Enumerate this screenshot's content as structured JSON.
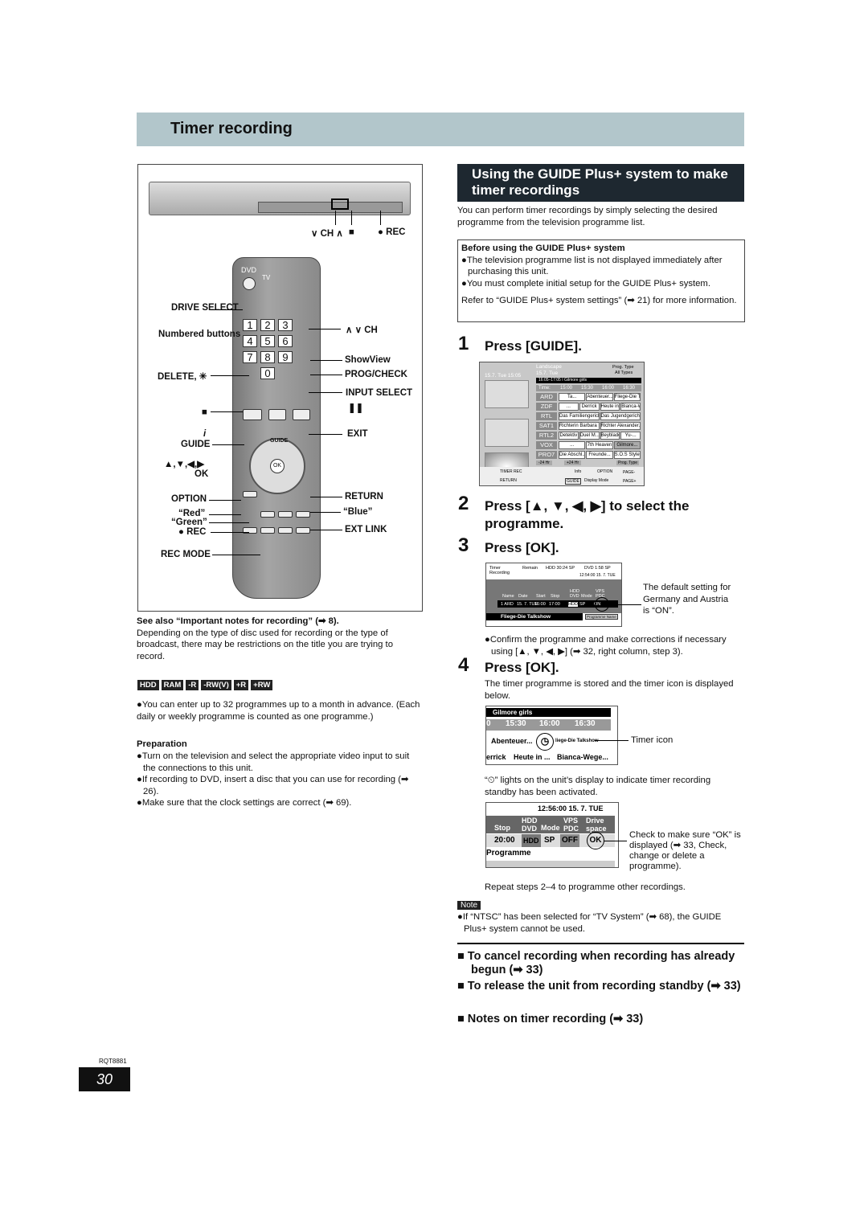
{
  "header": {
    "title": "Timer recording"
  },
  "left": {
    "unit_labels": {
      "ch": "∨ CH ∧",
      "stop": "■",
      "rec": "● REC"
    },
    "remote_labels_left": [
      "DRIVE SELECT",
      "Numbered buttons",
      "DELETE, ✳",
      "■",
      "i",
      "GUIDE",
      "▲,▼,◀,▶",
      "OK",
      "OPTION",
      "“Red”",
      "“Green”",
      "● REC",
      "REC MODE"
    ],
    "remote_labels_right": [
      "∧ ∨ CH",
      "ShowView",
      "PROG/CHECK",
      "INPUT SELECT",
      "❚❚",
      "EXIT",
      "RETURN",
      "“Blue”",
      "EXT LINK"
    ],
    "remote_text": {
      "dvd": "DVD",
      "tv": "TV",
      "guide": "GUIDE",
      "ok": "OK",
      "keys": [
        "1",
        "2",
        "3",
        "4",
        "5",
        "6",
        "7",
        "8",
        "9",
        "0"
      ]
    },
    "see_also": "See also “Important notes for recording” (➡ 8).",
    "restriction": "Depending on the type of disc used for recording or the type of broadcast, there may be restrictions on the title you are trying to record.",
    "discs": [
      "HDD",
      "RAM",
      "-R",
      "-RW(V)",
      "+R",
      "+RW"
    ],
    "programmes_note": "●You can enter up to 32 programmes up to a month in advance. (Each daily or weekly programme is counted as one programme.)",
    "preparation_title": "Preparation",
    "preparation": [
      "●Turn on the television and select the appropriate video input to suit the connections to this unit.",
      "●If recording to DVD, insert a disc that you can use for recording (➡ 26).",
      "●Make sure that the clock settings are correct (➡ 69)."
    ]
  },
  "right": {
    "section_title": "Using the GUIDE Plus+ system to make timer recordings",
    "intro": "You can perform timer recordings by simply selecting the desired programme from the television programme list.",
    "before": {
      "title": "Before using the GUIDE Plus+ system",
      "items": [
        "●The television programme list is not displayed immediately after purchasing this unit.",
        "●You must complete initial setup for the GUIDE Plus+ system."
      ],
      "refer": "Refer to “GUIDE Plus+ system settings” (➡ 21) for more information."
    },
    "steps": [
      {
        "num": "1",
        "text": "Press [GUIDE]."
      },
      {
        "num": "2",
        "text": "Press [▲, ▼, ◀, ▶] to select the programme."
      },
      {
        "num": "3",
        "text": "Press [OK]."
      },
      {
        "num": "4",
        "text": "Press [OK]."
      }
    ],
    "guide_screen": {
      "date": "15.7. Tue   15:05",
      "landscape": "Landscape",
      "date2": "15.7. Tue",
      "prog_type": "Prog. Type",
      "all_types": "All Types",
      "info_bar": "16:05–17:05 I     Gilmore girls",
      "time_label": "Time:",
      "times": [
        "15:00",
        "15:30",
        "16:00",
        "16:30"
      ],
      "channels": [
        {
          "ch": "ARD",
          "progs": [
            "Ta...",
            "Abenteuer...",
            "Fliege-Die Talkshow"
          ]
        },
        {
          "ch": "ZDF",
          "progs": [
            "...",
            "Derrick",
            "Heute in ...",
            "Bianca-Wege..."
          ]
        },
        {
          "ch": "RTL",
          "progs": [
            "Das Familiengericht",
            "Das Jugendgericht"
          ]
        },
        {
          "ch": "SAT1",
          "progs": [
            "Richterin Barbara Sa...",
            "Richter Alexander..."
          ]
        },
        {
          "ch": "RTL2",
          "progs": [
            "Detektiv",
            "Duel M...",
            "Beyblade",
            "Yu-..."
          ]
        },
        {
          "ch": "VOX",
          "progs": [
            "...",
            "7th Heaven",
            "Gilmore..."
          ]
        },
        {
          "ch": "PRO7",
          "progs": [
            "Die Abschl...",
            "Freunde...",
            "S.O.S Style &..."
          ]
        }
      ],
      "footer": [
        "-24 Hr",
        "+24 Hr",
        "Prog. Type",
        "TIMER REC",
        "Info",
        "OPTION",
        "PAGE-",
        "RETURN",
        "GUIDE",
        "Display Mode",
        "PAGE+"
      ]
    },
    "timer_screen": {
      "title": "Timer Recording",
      "remain": "Remain",
      "hdd": "HDD  30:24 SP",
      "dvd": "DVD  1:58 SP",
      "clock": "12:54:00  15. 7.  TUE",
      "cols": [
        "Name",
        "Date",
        "Start",
        "Stop",
        "HDD DVD",
        "Mode",
        "VPS PDC"
      ],
      "row": [
        "1 ARD",
        "15. 7. TUE",
        "16:00",
        "17:00",
        "HDD",
        "SP",
        "ON"
      ],
      "prog": "Fliege-Die Talkshow",
      "prog_btn": "Programme Name"
    },
    "default_note": "The default setting for Germany and Austria is “ON”.",
    "confirm": "●Confirm the programme and make corrections if necessary using [▲, ▼, ◀, ▶] (➡ 32, right column, step 3).",
    "stored": "The timer programme is stored and the timer icon is displayed below.",
    "timer_icon_screen": {
      "title": "Gilmore girls",
      "times": [
        "0",
        "15:30",
        "16:00",
        "16:30"
      ],
      "row1": [
        "Abenteuer...",
        "liege-Die Talkshow"
      ],
      "row2": [
        "errick",
        "Heute in ...",
        "Bianca-Wege..."
      ]
    },
    "timer_icon_label": "Timer icon",
    "lights": "“⏲” lights on the unit’s display to indicate timer recording standby has been activated.",
    "drive_screen": {
      "clock": "12:56:00   15. 7.  TUE",
      "cols": [
        "Stop",
        "HDD DVD",
        "Mode",
        "VPS PDC",
        "Drive space"
      ],
      "row": [
        "20:00",
        "HDD",
        "SP",
        "OFF",
        "OK"
      ],
      "prog": "Programme"
    },
    "check_note": "Check to make sure “OK” is displayed (➡ 33, Check, change or delete a programme).",
    "repeat": "Repeat steps 2–4 to programme other recordings.",
    "note_label": "Note",
    "note": "●If “NTSC” has been selected for “TV System” (➡ 68), the GUIDE Plus+ system cannot be used.",
    "links": [
      "■ To cancel recording when recording has already begun (➡ 33)",
      "■ To release the unit from recording standby (➡ 33)",
      "■ Notes on timer recording (➡ 33)"
    ]
  },
  "footer": {
    "code": "RQT8881",
    "page": "30"
  }
}
